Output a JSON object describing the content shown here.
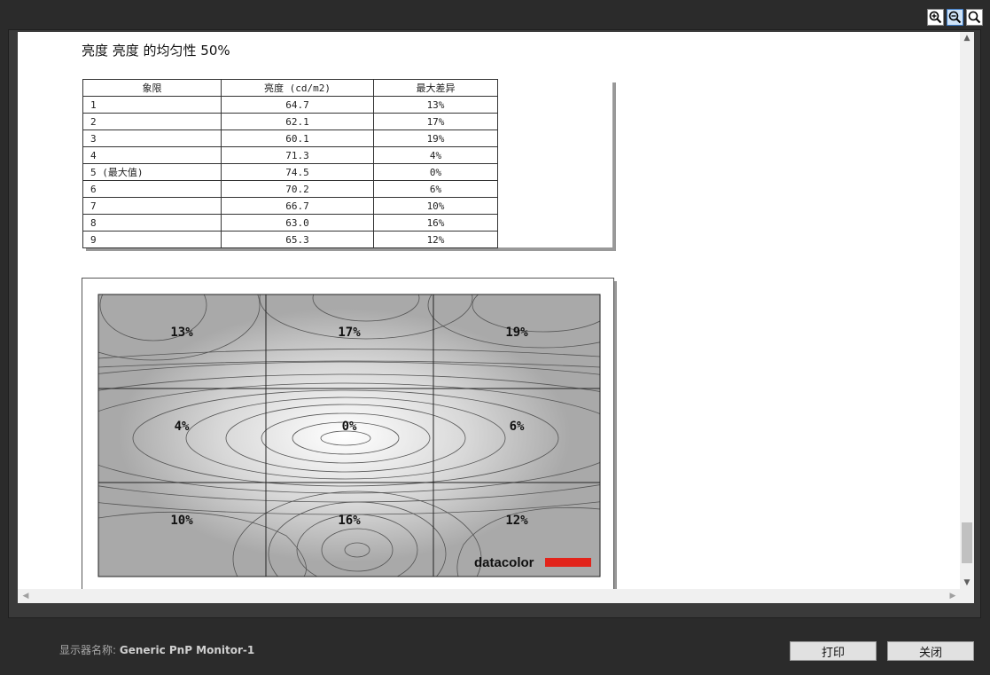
{
  "toolbar": {
    "zoom_in_icon": "zoom-in-icon",
    "zoom_out_icon": "zoom-out-icon",
    "zoom_fit_icon": "zoom-fit-icon"
  },
  "report": {
    "title": "亮度 亮度 的均匀性 50%",
    "table": {
      "headers": [
        "象限",
        "亮度 (cd/m2)",
        "最大差异"
      ],
      "rows": [
        [
          "1",
          "64.7",
          "13%"
        ],
        [
          "2",
          "62.1",
          "17%"
        ],
        [
          "3",
          "60.1",
          "19%"
        ],
        [
          "4",
          "71.3",
          "4%"
        ],
        [
          "5 (最大值)",
          "74.5",
          "0%"
        ],
        [
          "6",
          "70.2",
          "6%"
        ],
        [
          "7",
          "66.7",
          "10%"
        ],
        [
          "8",
          "63.0",
          "16%"
        ],
        [
          "9",
          "65.3",
          "12%"
        ]
      ]
    },
    "chart": {
      "cells": [
        "13%",
        "17%",
        "19%",
        "4%",
        "0%",
        "6%",
        "10%",
        "16%",
        "12%"
      ],
      "logo": "datacolor"
    }
  },
  "chart_data": {
    "type": "heatmap",
    "grid": "3x3",
    "values": [
      [
        13,
        17,
        19
      ],
      [
        4,
        0,
        6
      ],
      [
        10,
        16,
        12
      ]
    ],
    "labels": [
      [
        "13%",
        "17%",
        "19%"
      ],
      [
        "4%",
        "0%",
        "6%"
      ],
      [
        "10%",
        "16%",
        "12%"
      ]
    ]
  },
  "footer": {
    "monitor_label": "显示器名称:",
    "monitor_name": "Generic PnP Monitor-1",
    "print_button": "打印",
    "close_button": "关闭"
  }
}
